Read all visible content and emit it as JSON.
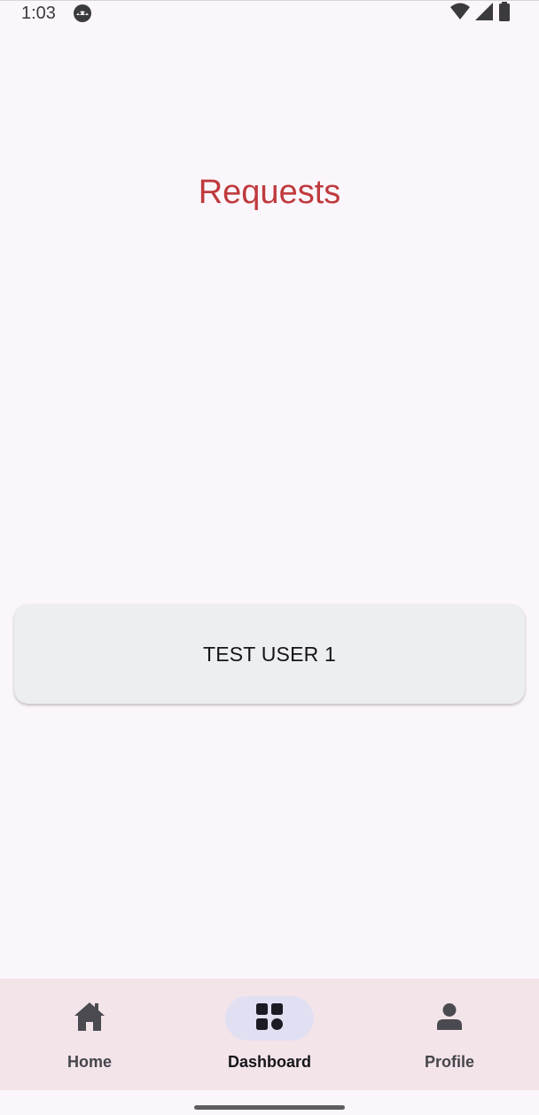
{
  "status_bar": {
    "time": "1:03",
    "app_icon": "android-debug-icon",
    "icons": [
      "wifi-icon",
      "cellular-signal-icon",
      "battery-icon"
    ]
  },
  "page": {
    "title": "Requests",
    "title_color": "#bf3a3d"
  },
  "requests": [
    {
      "name": "TEST USER 1"
    }
  ],
  "bottom_nav": {
    "items": [
      {
        "label": "Home",
        "icon": "home-icon",
        "active": false
      },
      {
        "label": "Dashboard",
        "icon": "dashboard-icon",
        "active": true
      },
      {
        "label": "Profile",
        "icon": "person-icon",
        "active": false
      }
    ]
  },
  "colors": {
    "background": "#fbf6fb",
    "card": "#edeef2",
    "nav_bar": "#f3e4ea",
    "active_indicator": "#e1dff2"
  }
}
